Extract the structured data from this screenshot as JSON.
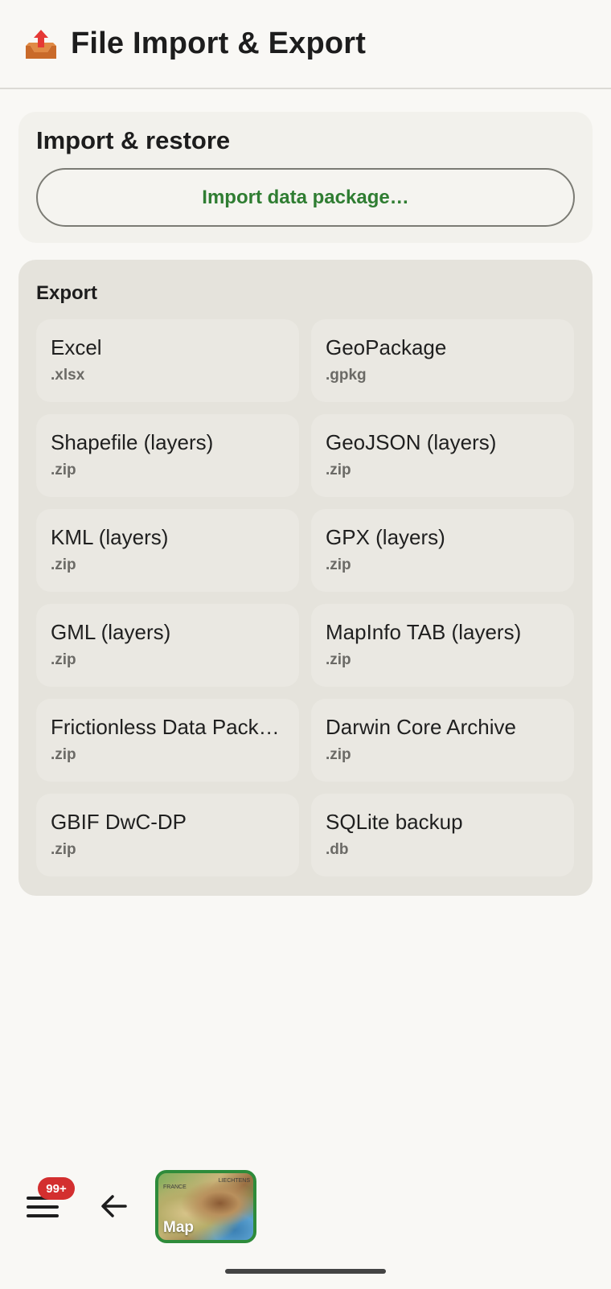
{
  "header": {
    "icon": "outbox-tray-icon",
    "title": "File Import & Export"
  },
  "import_section": {
    "title": "Import & restore",
    "button_label": "Import data package…"
  },
  "export_section": {
    "title": "Export",
    "formats": [
      {
        "name": "Excel",
        "ext": ".xlsx"
      },
      {
        "name": "GeoPackage",
        "ext": ".gpkg"
      },
      {
        "name": "Shapefile (layers)",
        "ext": ".zip"
      },
      {
        "name": "GeoJSON (layers)",
        "ext": ".zip"
      },
      {
        "name": "KML (layers)",
        "ext": ".zip"
      },
      {
        "name": "GPX (layers)",
        "ext": ".zip"
      },
      {
        "name": "GML (layers)",
        "ext": ".zip"
      },
      {
        "name": "MapInfo TAB (layers)",
        "ext": ".zip"
      },
      {
        "name": "Frictionless Data Pack…",
        "ext": ".zip"
      },
      {
        "name": "Darwin Core Archive",
        "ext": ".zip"
      },
      {
        "name": "GBIF DwC-DP",
        "ext": ".zip"
      },
      {
        "name": "SQLite backup",
        "ext": ".db"
      }
    ]
  },
  "bottom_bar": {
    "menu_badge": "99+",
    "map_label": "Map",
    "map_place_labels": [
      "FRANCE",
      "LIECHTENS"
    ]
  },
  "colors": {
    "accent_green": "#2f7d32",
    "badge_red": "#d32f2f",
    "export_card_bg": "#e5e3dc"
  }
}
